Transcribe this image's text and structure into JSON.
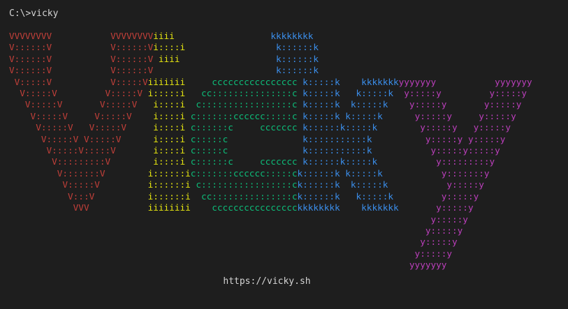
{
  "terminal": {
    "prompt": "C:\\>vicky",
    "url": "https://vicky.sh"
  },
  "colors": {
    "background": "#1e1e1e",
    "text": "#d4d4d4",
    "red": "#c4403a",
    "yellow": "#e5e510",
    "green": "#0dbc79",
    "blue": "#3b8eea",
    "magenta": "#bc3fbc"
  },
  "banner": {
    "rows": [
      {
        "v": "VVVVVVVV           VVVVVVVV",
        "i": "iiii",
        "c": "                  ",
        "k": "kkkkkkkk",
        "y": ""
      },
      {
        "v": "V::::::V           V::::::V",
        "i": "i::::i",
        "c": "                 ",
        "k": "k::::::k",
        "y": ""
      },
      {
        "v": "V::::::V           V::::::V",
        "i": " iiii",
        "c": "                  ",
        "k": "k::::::k",
        "y": ""
      },
      {
        "v": "V::::::V           V::::::V",
        "i": "      ",
        "c": "                 ",
        "k": "k::::::k",
        "y": ""
      },
      {
        "v": " V:::::V           V:::::V",
        "i": "iiiiiii",
        "c": "     cccccccccccccccc ",
        "k": "k:::::k    kkkkkkk",
        "y": "yyyyyyy           yyyyyyy"
      },
      {
        "v": "  V:::::V         V:::::V ",
        "i": "i:::::i",
        "c": "   cc:::::::::::::::c ",
        "k": "k:::::k   k:::::k ",
        "y": " y:::::y         y:::::y"
      },
      {
        "v": "   V:::::V       V:::::V  ",
        "i": " i::::i",
        "c": "  c:::::::::::::::::c ",
        "k": "k:::::k  k:::::k  ",
        "y": "  y:::::y       y:::::y"
      },
      {
        "v": "    V:::::V     V:::::V   ",
        "i": " i::::i",
        "c": " c:::::::cccccc:::::c ",
        "k": "k:::::k k:::::k   ",
        "y": "   y:::::y     y:::::y"
      },
      {
        "v": "     V:::::V   V:::::V    ",
        "i": " i::::i",
        "c": " c::::::c     ccccccc ",
        "k": "k::::::k:::::k    ",
        "y": "    y:::::y   y:::::y"
      },
      {
        "v": "      V:::::V V:::::V     ",
        "i": " i::::i",
        "c": " c:::::c              ",
        "k": "k:::::::::::k     ",
        "y": "     y:::::y y:::::y"
      },
      {
        "v": "       V:::::V:::::V      ",
        "i": " i::::i",
        "c": " c:::::c              ",
        "k": "k:::::::::::k     ",
        "y": "      y:::::y:::::y"
      },
      {
        "v": "        V:::::::::V       ",
        "i": " i::::i",
        "c": " c::::::c     ccccccc ",
        "k": "k::::::k:::::k    ",
        "y": "       y:::::::::y"
      },
      {
        "v": "         V:::::::V        ",
        "i": "i::::::i",
        "c": "c:::::::cccccc:::::c",
        "k": "k::::::k k:::::k   ",
        "y": "        y:::::::y"
      },
      {
        "v": "          V:::::V         ",
        "i": "i::::::i",
        "c": " c:::::::::::::::::c",
        "k": "k::::::k  k:::::k  ",
        "y": "         y:::::y"
      },
      {
        "v": "           V:::V          ",
        "i": "i::::::i",
        "c": "  cc:::::::::::::::c",
        "k": "k::::::k   k:::::k ",
        "y": "        y:::::y"
      },
      {
        "v": "            VVV           ",
        "i": "iiiiiiii",
        "c": "    cccccccccccccccc",
        "k": "kkkkkkkk    kkkkkkk",
        "y": "       y:::::y"
      },
      {
        "v": "                          ",
        "i": "        ",
        "c": "                    ",
        "k": "                   ",
        "y": "      y:::::y"
      },
      {
        "v": "                          ",
        "i": "        ",
        "c": "                    ",
        "k": "                   ",
        "y": "     y:::::y"
      },
      {
        "v": "                          ",
        "i": "        ",
        "c": "                    ",
        "k": "                   ",
        "y": "    y:::::y"
      },
      {
        "v": "                          ",
        "i": "        ",
        "c": "                    ",
        "k": "                   ",
        "y": "   y:::::y"
      },
      {
        "v": "                          ",
        "i": "        ",
        "c": "                    ",
        "k": "                   ",
        "y": "  yyyyyyy"
      }
    ]
  }
}
